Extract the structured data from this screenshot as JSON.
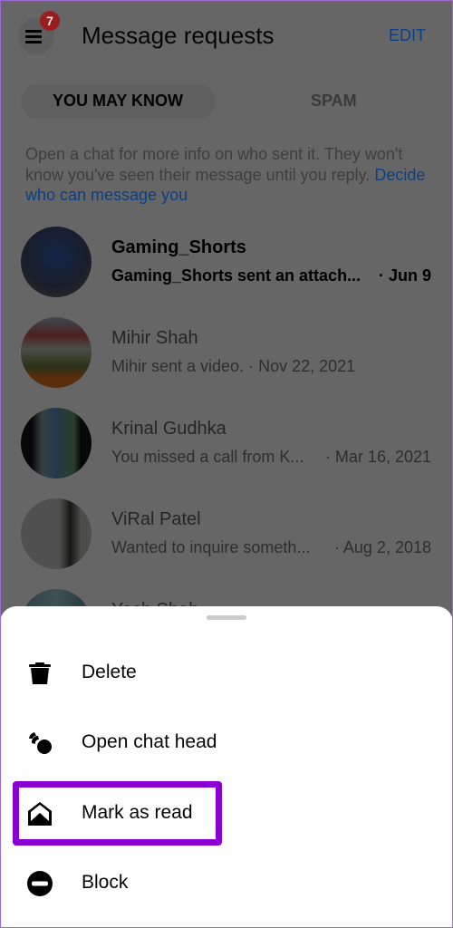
{
  "header": {
    "title": "Message requests",
    "edit_label": "EDIT",
    "badge_count": "7",
    "menu_icon": "hamburger-icon"
  },
  "tabs": [
    {
      "label": "YOU MAY KNOW",
      "active": true
    },
    {
      "label": "SPAM",
      "active": false
    }
  ],
  "info": {
    "text": "Open a chat for more info on who sent it. They won't know you've seen their message until you reply.",
    "link": "Decide who can message you"
  },
  "conversations": [
    {
      "name": "Gaming_Shorts",
      "preview": "Gaming_Shorts sent an attach...",
      "date": "· Jun 9",
      "unread": true
    },
    {
      "name": "Mihir Shah",
      "preview": "Mihir sent a video.",
      "date": "· Nov 22, 2021",
      "unread": false
    },
    {
      "name": "Krinal Gudhka",
      "preview": "You missed a call from K...",
      "date": "· Mar 16, 2021",
      "unread": false
    },
    {
      "name": "ViRal Patel",
      "preview": "Wanted to inquire someth...",
      "date": "· Aug 2, 2018",
      "unread": false
    },
    {
      "name": "Yash Shah",
      "preview": "",
      "date": "",
      "unread": false
    }
  ],
  "sheet": {
    "items": [
      {
        "label": "Delete",
        "icon": "trash-icon"
      },
      {
        "label": "Open chat head",
        "icon": "chat-head-icon"
      },
      {
        "label": "Mark as read",
        "icon": "envelope-open-icon",
        "highlighted": true
      },
      {
        "label": "Block",
        "icon": "block-icon"
      }
    ]
  },
  "colors": {
    "accent": "#1a6ad8",
    "badge": "#e0292b",
    "highlight": "#8a00d4"
  }
}
